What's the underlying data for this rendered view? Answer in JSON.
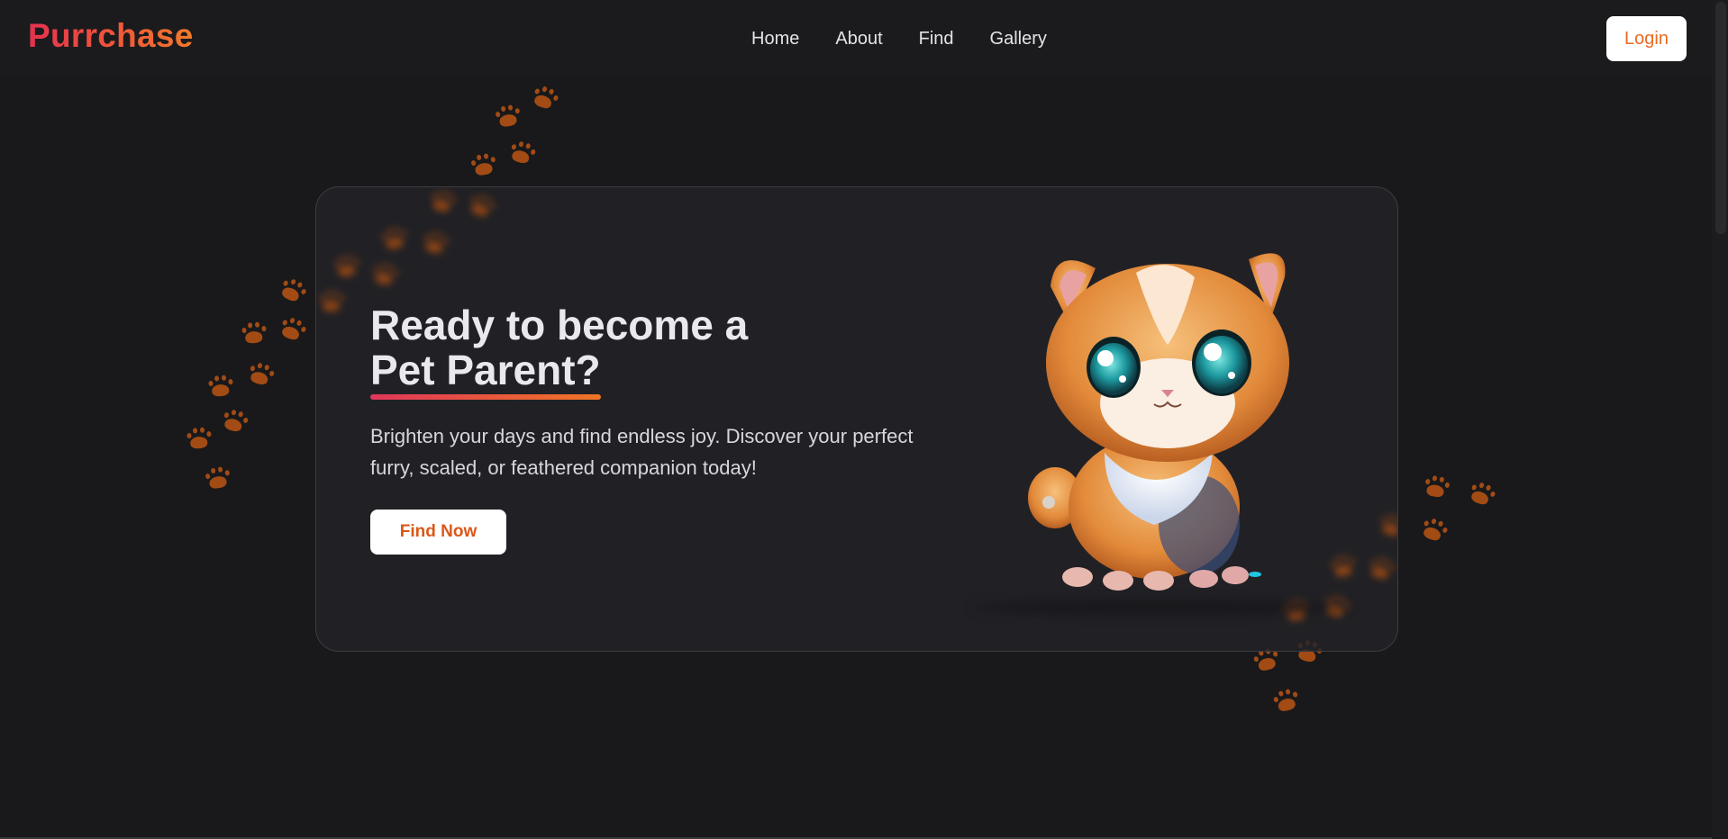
{
  "brand": {
    "name": "Purrchase"
  },
  "nav": {
    "items": [
      {
        "label": "Home"
      },
      {
        "label": "About"
      },
      {
        "label": "Find"
      },
      {
        "label": "Gallery"
      }
    ]
  },
  "header": {
    "login_label": "Login"
  },
  "hero": {
    "title_line1": "Ready to become a",
    "title_line2": "Pet Parent?",
    "subtitle": "Brighten your days and find endless joy. Discover your perfect furry, scaled, or feathered companion today!",
    "cta_label": "Find Now",
    "image": "kitten-illustration"
  },
  "colors": {
    "background": "#19191b",
    "card": "#232328",
    "brand_gradient_start": "#e6324f",
    "brand_gradient_end": "#f37a2a",
    "accent_orange": "#ea6a22",
    "paw": "#a24b14"
  },
  "icons": [
    "paw-print-icon"
  ]
}
